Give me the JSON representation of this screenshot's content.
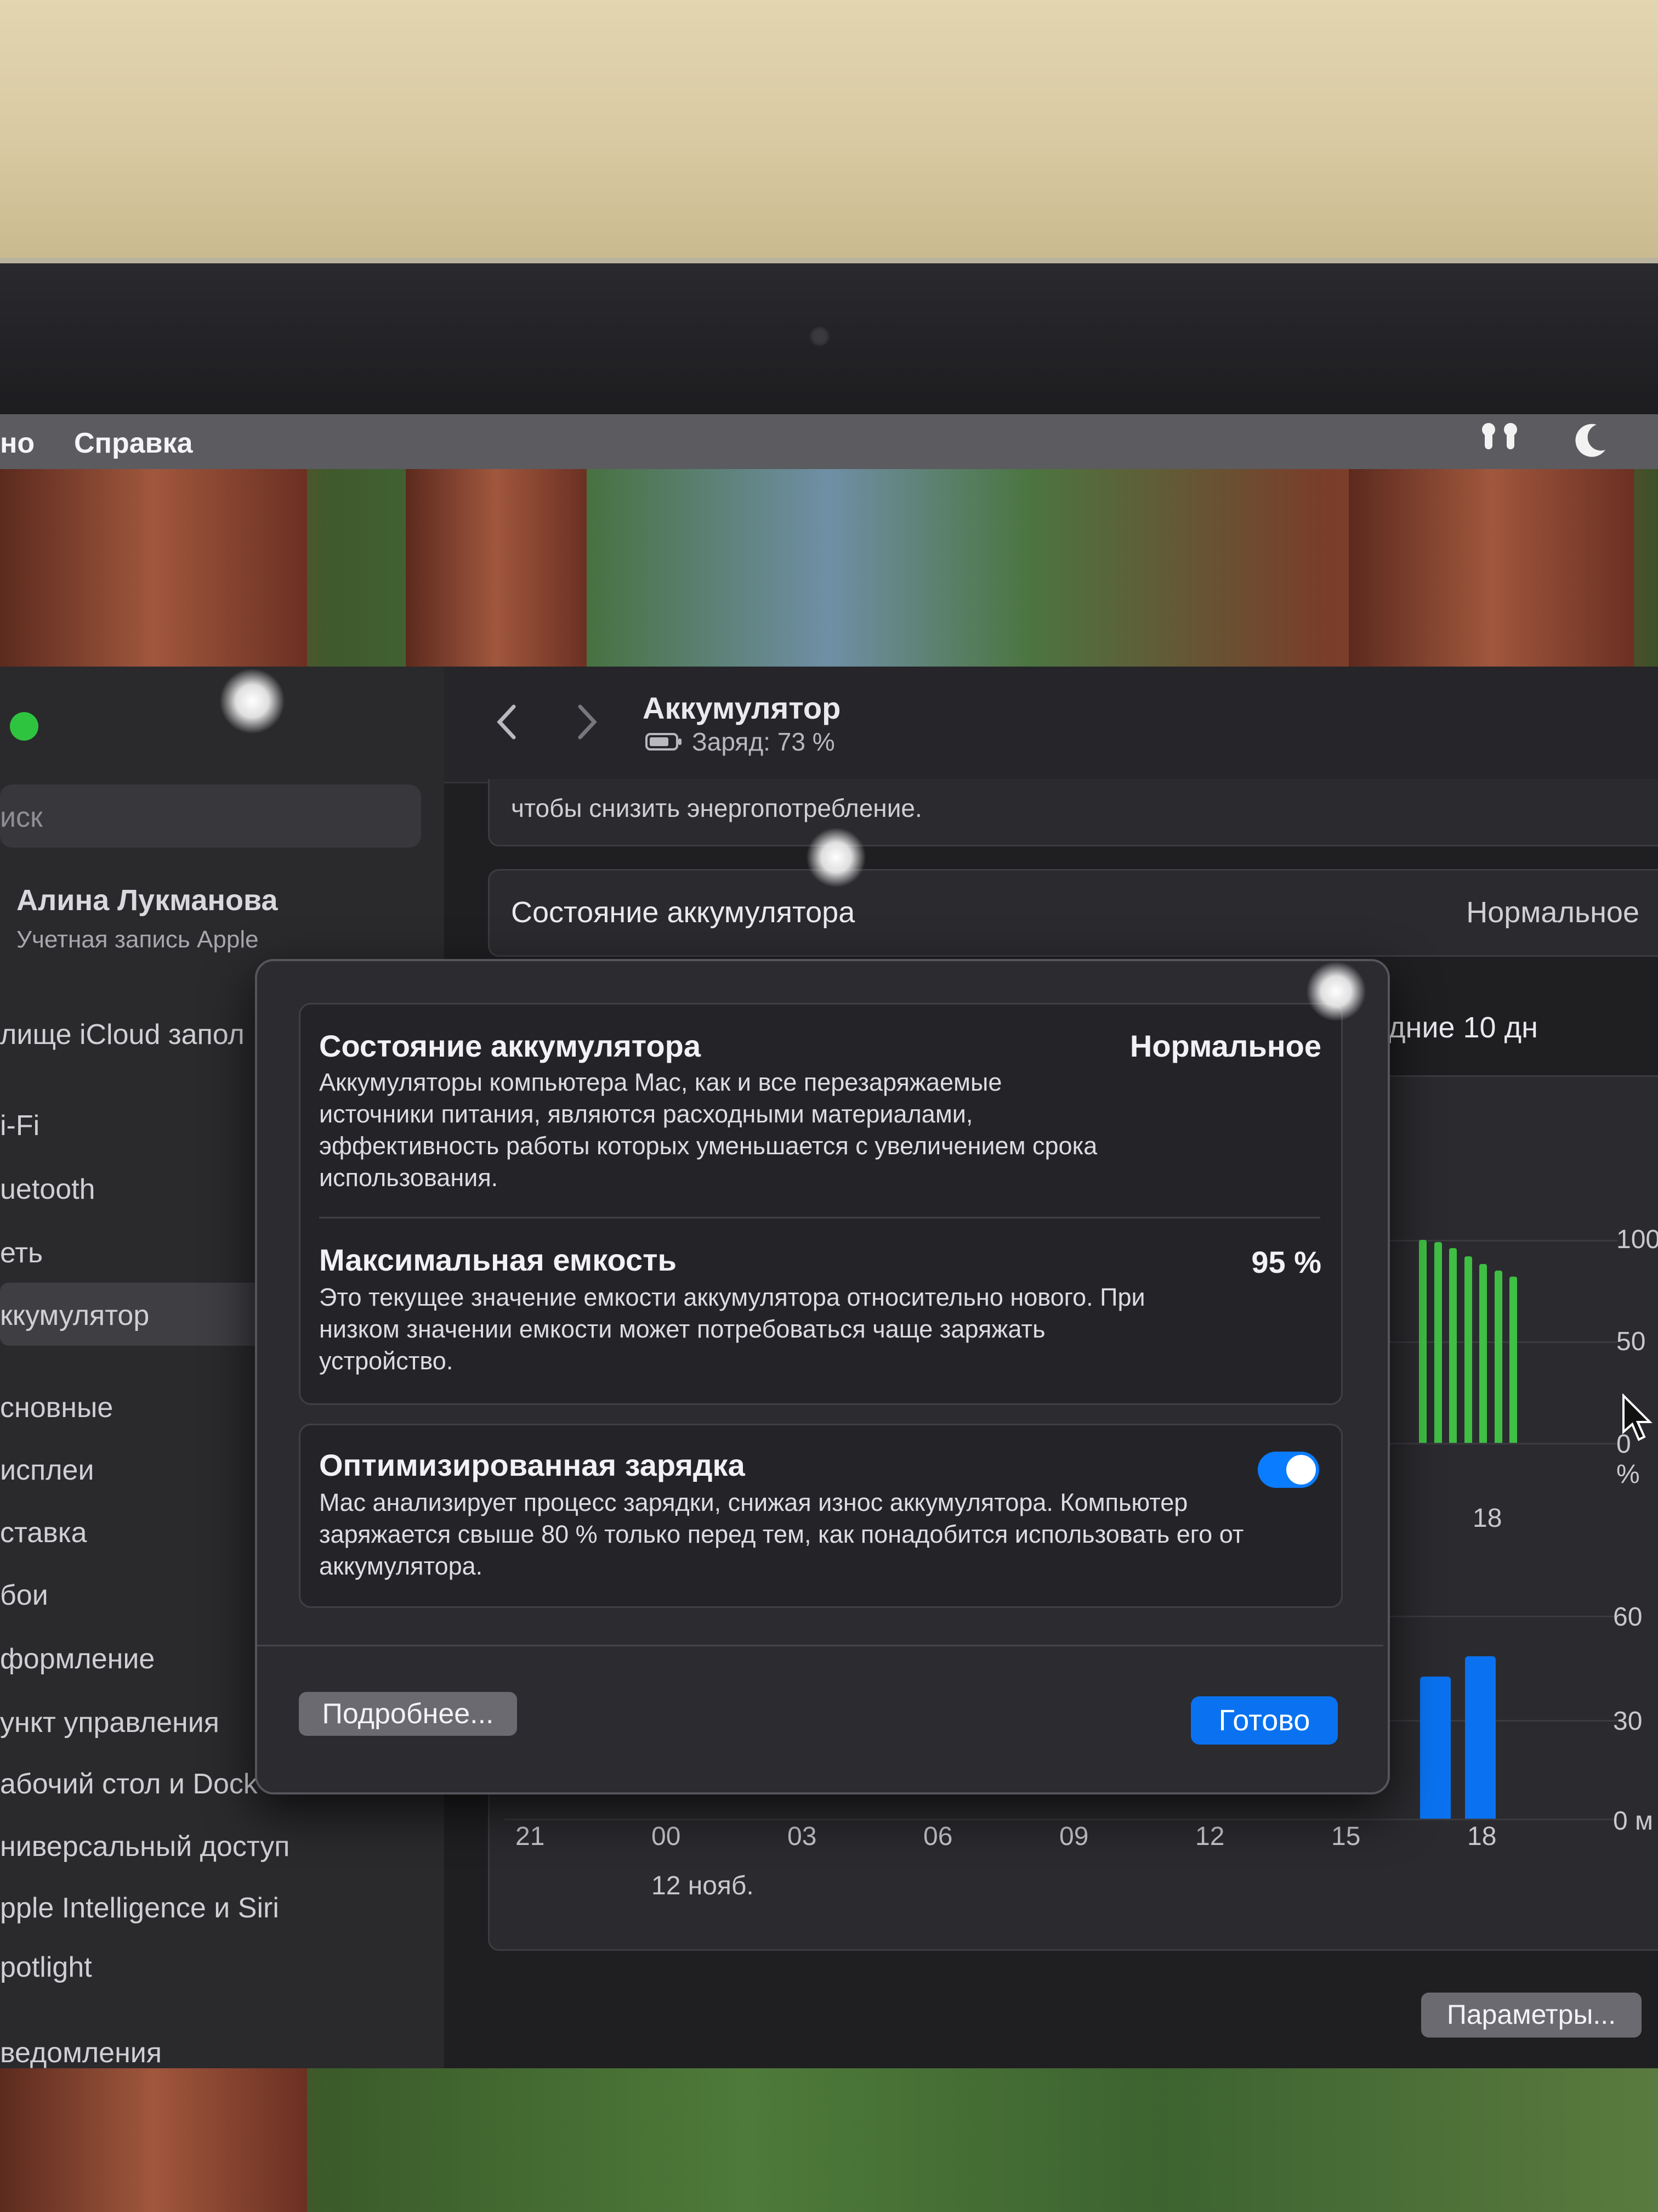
{
  "menubar": {
    "partial_item": "но",
    "help": "Справка"
  },
  "toolbar": {
    "title": "Аккумулятор",
    "subtitle": "Заряд: 73 %"
  },
  "sidebar": {
    "search_placeholder": "иск",
    "account_name": "Алина Лукманова",
    "account_sub": "Учетная запись Apple",
    "items": [
      "лище iCloud запол",
      "i-Fi",
      "uetooth",
      "еть",
      "ккумулятор",
      "сновные",
      "исплеи",
      "ставка",
      "бои",
      "формление",
      "ункт управления",
      "абочий стол и Dock",
      "ниверсальный доступ",
      "pple Intelligence и Siri",
      "potlight",
      "ведомления"
    ]
  },
  "content": {
    "partial_text": "чтобы снизить энергопотребление.",
    "health_label": "Состояние аккумулятора",
    "health_value": "Нормальное",
    "period_partial": "дние 10 дн",
    "settings_button": "Параметры..."
  },
  "chart_data": [
    {
      "type": "bar",
      "title": "",
      "ylim": [
        0,
        100
      ],
      "y_ticks": [
        "100",
        "50",
        "0 %"
      ],
      "x_ticks": [
        "18"
      ],
      "series": [
        {
          "values": [
            100,
            99,
            96,
            92,
            88,
            85,
            82
          ]
        }
      ],
      "color": "#3fbf44"
    },
    {
      "type": "bar",
      "title": "",
      "ylim": [
        0,
        60
      ],
      "y_ticks": [
        "60",
        "30",
        "0 м"
      ],
      "x_ticks": [
        "21",
        "00",
        "03",
        "06",
        "09",
        "12",
        "15",
        "18"
      ],
      "x_sublabel": "12 нояб.",
      "series": [
        {
          "values": [
            42,
            48
          ]
        }
      ],
      "color": "#0a72f0"
    }
  ],
  "modal": {
    "health": {
      "title": "Состояние аккумулятора",
      "value": "Нормальное",
      "description": "Аккумуляторы компьютера Mac, как и все перезаряжаемые источники питания, являются расходными материалами, эффективность работы которых уменьшается с увеличением срока использования."
    },
    "capacity": {
      "title": "Максимальная емкость",
      "value": "95 %",
      "description": "Это текущее значение емкости аккумулятора относительно нового. При низком значении емкости может потребоваться чаще заряжать устройство."
    },
    "optimized": {
      "title": "Оптимизированная зарядка",
      "enabled": true,
      "description": "Mac анализирует процесс зарядки, снижая износ аккумулятора. Компьютер заряжается свыше 80 % только перед тем, как понадобится использовать его от аккумулятора."
    },
    "more_button": "Подробнее...",
    "done_button": "Готово"
  }
}
